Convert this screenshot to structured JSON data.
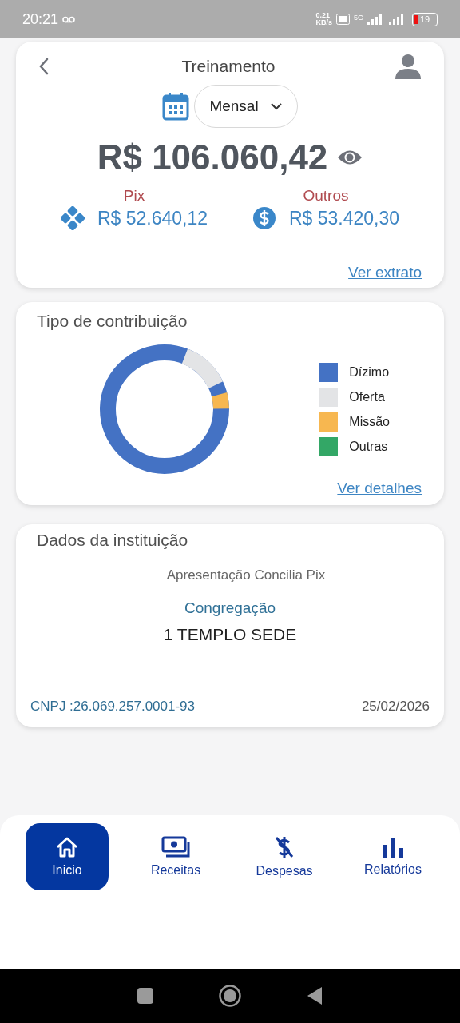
{
  "status_bar": {
    "time": "20:21",
    "speed": "0.21",
    "speed_unit": "KB/s",
    "network": "5G",
    "battery": "19"
  },
  "summary": {
    "title": "Treinamento",
    "period": "Mensal",
    "total": "R$ 106.060,42",
    "methods": [
      {
        "kind": "pix",
        "label": "Pix",
        "amount": "R$ 52.640,12"
      },
      {
        "kind": "other",
        "label": "Outros",
        "amount": "R$ 53.420,30"
      }
    ],
    "link": "Ver extrato"
  },
  "contributions": {
    "title": "Tipo de contribuição",
    "legend": [
      {
        "label": "Dízimo",
        "color": "#4472c4"
      },
      {
        "label": "Oferta",
        "color": "#e3e4e6"
      },
      {
        "label": "Missão",
        "color": "#f7b750"
      },
      {
        "label": "Outras",
        "color": "#33a766"
      }
    ],
    "link": "Ver detalhes"
  },
  "institution": {
    "title": "Dados da instituição",
    "name": "Apresentação Concilia Pix",
    "congregation_label": "Congregação",
    "congregation": "1 TEMPLO SEDE",
    "cnpj": "CNPJ :26.069.257.0001-93",
    "date": "25/02/2026"
  },
  "nav": [
    {
      "kind": "home",
      "label": "Inicio",
      "selected": true
    },
    {
      "kind": "income",
      "label": "Receitas",
      "selected": false
    },
    {
      "kind": "expense",
      "label": "Despesas",
      "selected": false
    },
    {
      "kind": "reports",
      "label": "Relatórios",
      "selected": false
    }
  ]
}
